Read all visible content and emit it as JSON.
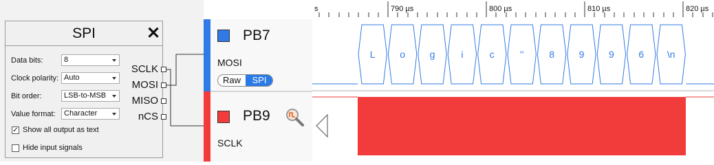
{
  "spi_block": {
    "title": "SPI",
    "options": [
      {
        "label": "Data bits:",
        "value": "8"
      },
      {
        "label": "Clock polarity:",
        "value": "Auto"
      },
      {
        "label": "Bit order:",
        "value": "LSB-to-MSB"
      },
      {
        "label": "Value format:",
        "value": "Character"
      }
    ],
    "checkboxes": [
      {
        "label": "Show all output as text",
        "checked": true
      },
      {
        "label": "Hide input signals",
        "checked": false
      }
    ],
    "ports": [
      "SCLK",
      "MOSI",
      "MISO",
      "nCS"
    ]
  },
  "channels": [
    {
      "name": "PB7",
      "signal": "MOSI",
      "color": "#2f7ae5"
    },
    {
      "name": "PB9",
      "signal": "SCLK",
      "color": "#f23b3b"
    }
  ],
  "toggle": {
    "raw": "Raw",
    "spi": "SPI",
    "selected": "SPI"
  },
  "timeline": {
    "cut_label": "s",
    "ticks": [
      "790 µs",
      "800 µs",
      "810 µs",
      "820 µs"
    ]
  },
  "decoded_bytes": [
    "L",
    "o",
    "g",
    "i",
    "c",
    "''",
    "8",
    "9",
    "9",
    "6",
    "\\n"
  ],
  "colors": {
    "mosi": "#2f7ae5",
    "sclk": "#f23b3b",
    "wire": "#333333"
  }
}
